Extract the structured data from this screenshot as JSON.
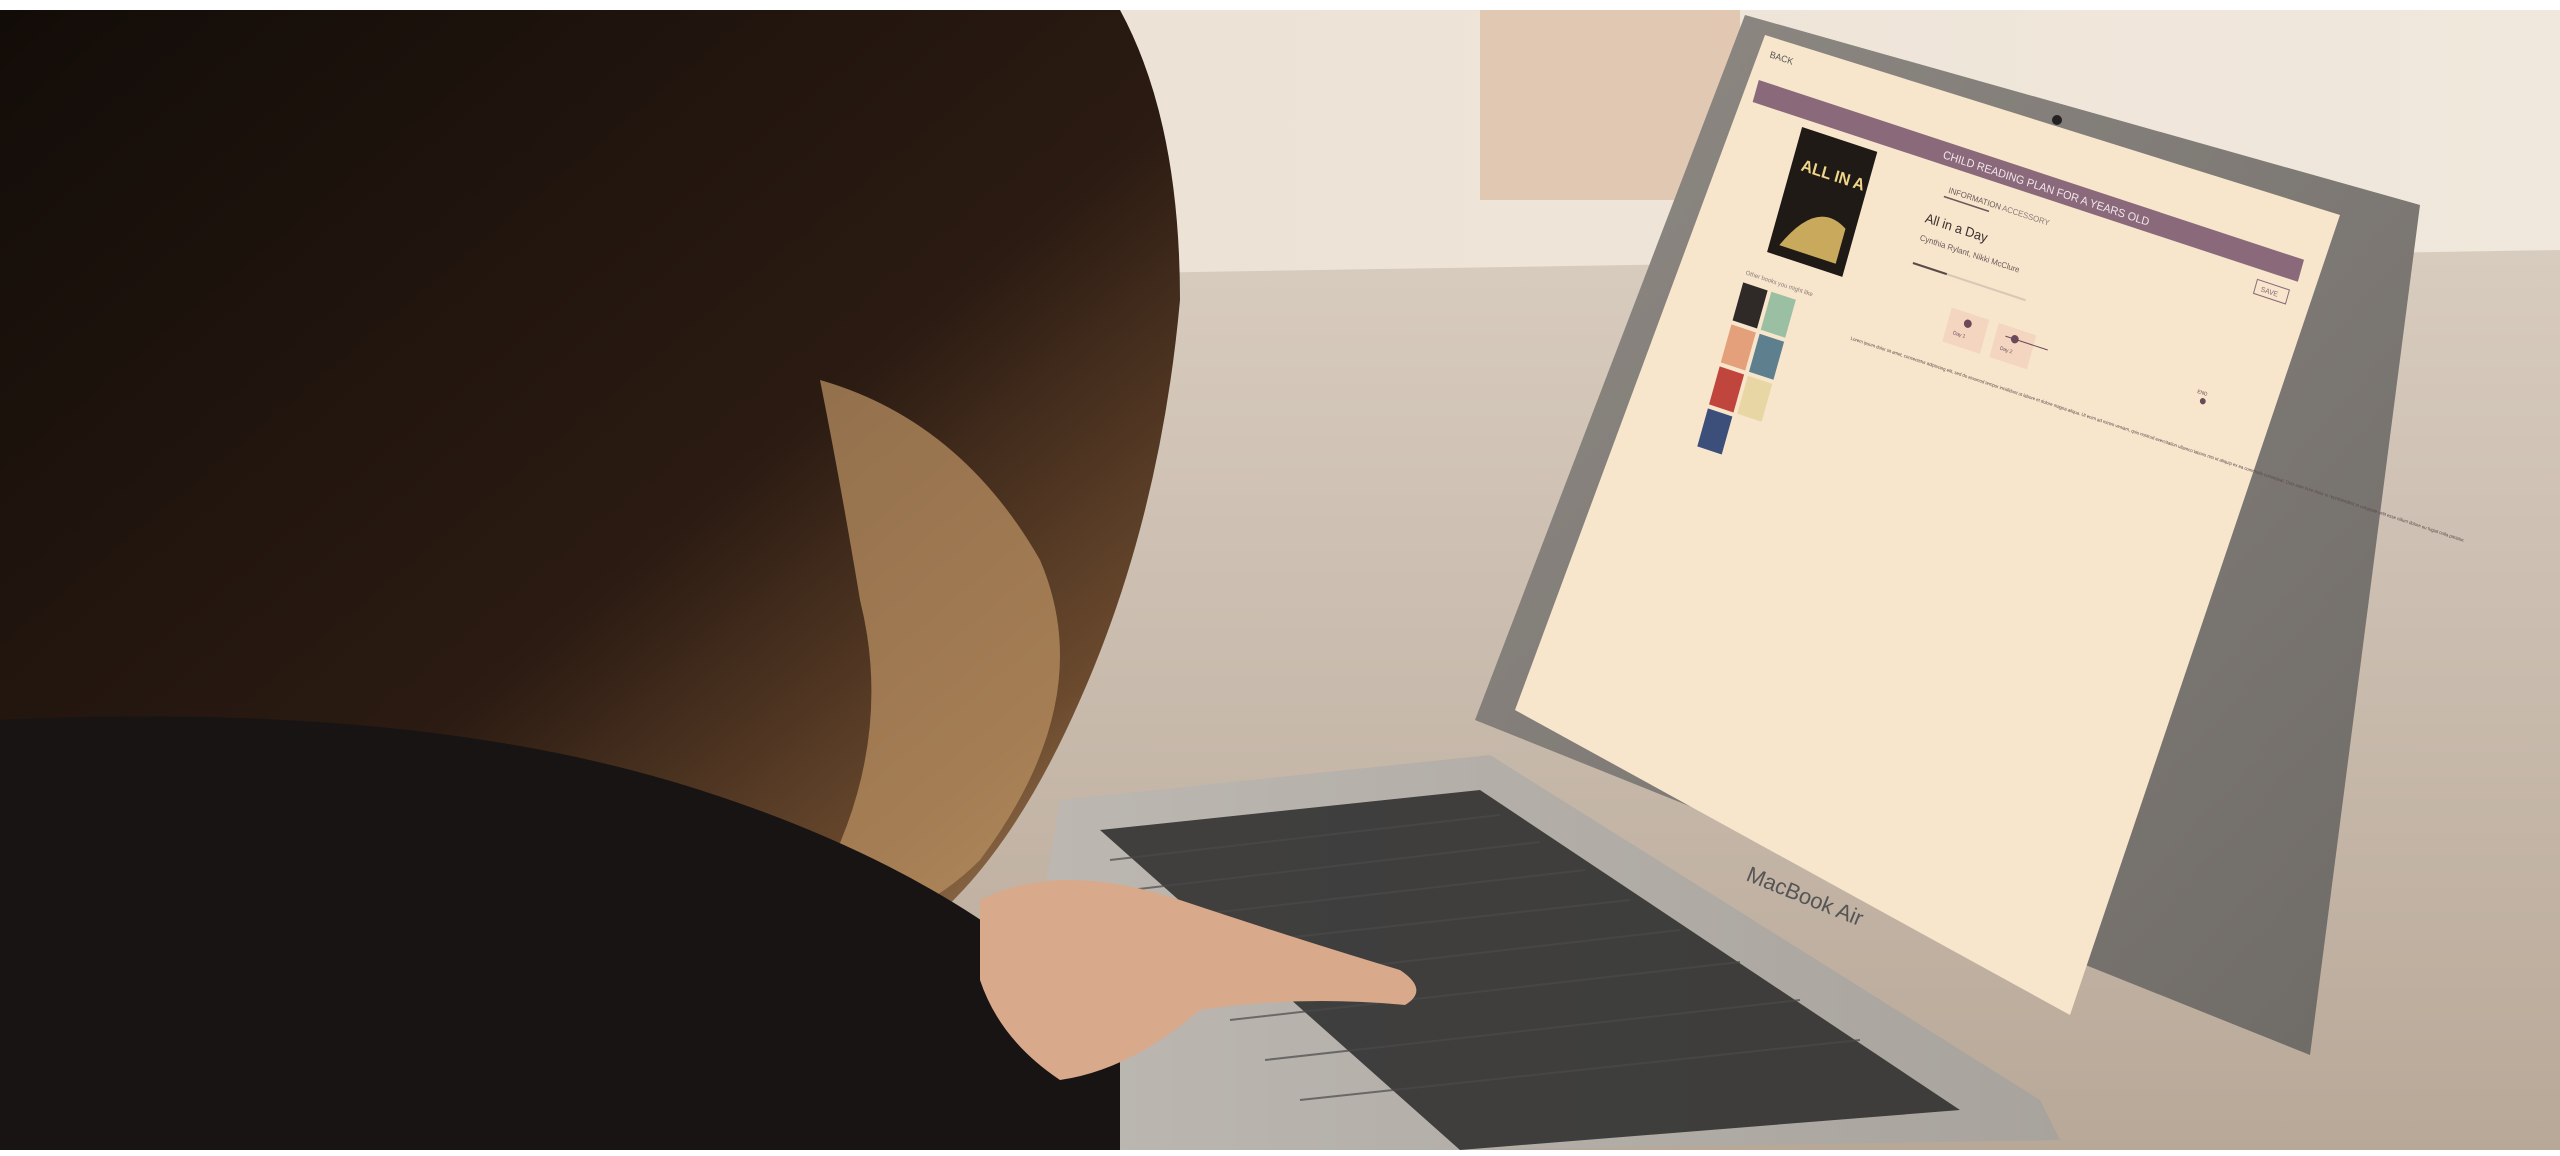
{
  "screen": {
    "nav": {
      "back_label": "BACK"
    },
    "header": {
      "title": "CHILD READING PLAN FOR A YEARS OLD"
    },
    "tabs": [
      {
        "label": "INFORMATION",
        "active": true
      },
      {
        "label": "ACCESSORY",
        "active": false
      }
    ],
    "corner_button_label": "SAVE",
    "book": {
      "cover_title": "ALL IN A",
      "title": "All in a Day",
      "subtitle": "Cynthia Rylant, Nikki McClure"
    },
    "progress": {
      "value": 0.3
    },
    "shelf_caption": "Other books you might like",
    "timeline_labels": [
      "Day 1",
      "Day 2"
    ],
    "side_dot_label": "END",
    "description": "Lorem ipsum dolor sit amet, consectetur adipiscing elit, sed do eiusmod tempor incididunt ut labore et dolore magna aliqua. Ut enim ad minim veniam, quis nostrud exercitation ullamco laboris nisi ut aliquip ex ea commodo consequat. Duis aute irure dolor in reprehenderit in voluptate velit esse cillum dolore eu fugiat nulla pariatur."
  },
  "laptop": {
    "brand": "MacBook Air"
  },
  "colors": {
    "accent": "#8a6a7a",
    "screen_bg": "#f7e6cc",
    "wall": "#efe4d6",
    "table": "#cfc1b3",
    "hair_dark": "#1c130e",
    "hair_light": "#c19a6b"
  }
}
